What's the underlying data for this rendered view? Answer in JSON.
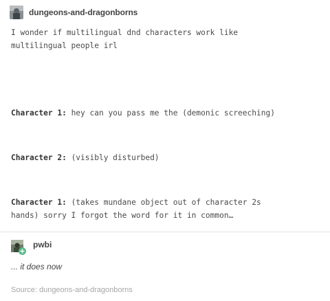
{
  "post": {
    "blog_name": "dungeons-and-dragonborns",
    "avatar_icon": "blog-avatar-icon",
    "intro": "I wonder if multilingual dnd characters work like\nmultilingual people irl",
    "lines": [
      {
        "speaker": "Character 1:",
        "text": " hey can you pass me the (demonic screeching)"
      },
      {
        "speaker": "Character 2:",
        "text": " (visibly disturbed)"
      },
      {
        "speaker": "Character 1:",
        "text": " (takes mundane object out of character 2s\nhands) sorry I forgot the word for it in common…"
      }
    ]
  },
  "reply": {
    "blog_name": "pwbi",
    "avatar_icon": "reply-avatar-icon",
    "badge_icon": "follow-plus-badge-icon",
    "badge_color": "#56bc8a",
    "text": "... it does now"
  },
  "source": {
    "text": "Source: dungeons-and-dragonborns"
  }
}
